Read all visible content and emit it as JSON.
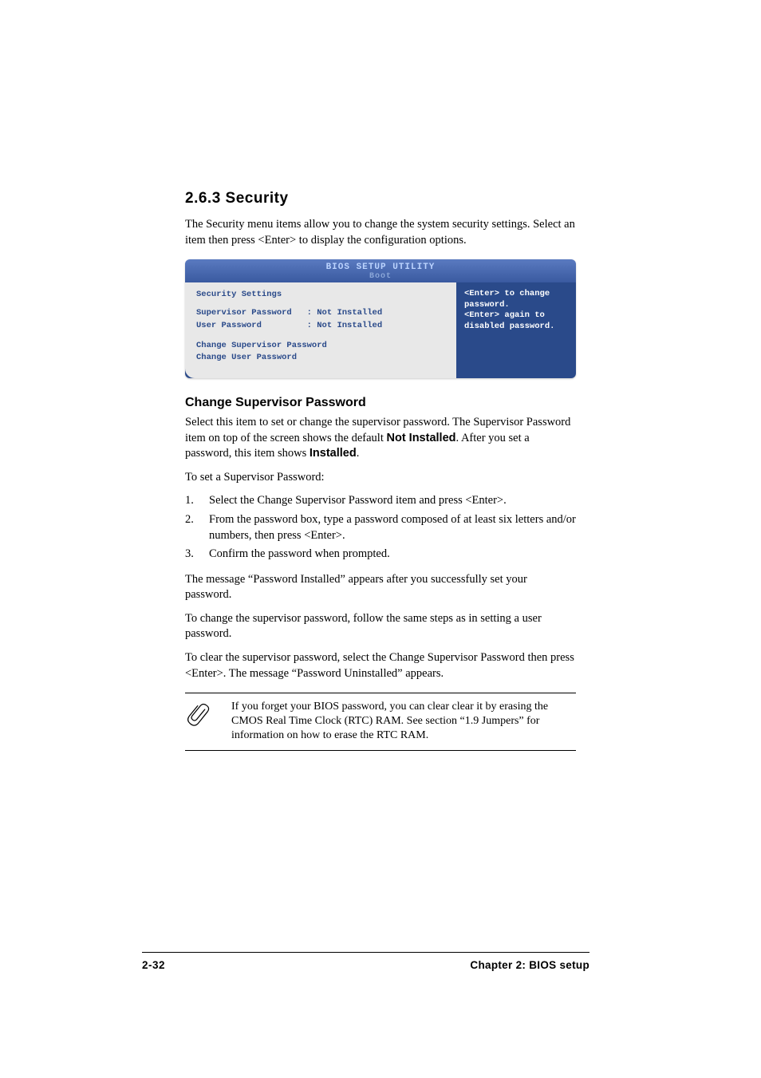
{
  "section": {
    "number": "2.6.3",
    "title": "Security",
    "heading": "2.6.3   Security"
  },
  "intro": "The Security menu items allow you to change the system security settings. Select an item then press <Enter> to display the configuration options.",
  "bios": {
    "header_title": "BIOS SETUP UTILITY",
    "header_sub": "Boot",
    "left_title": "Security Settings",
    "rows": [
      {
        "label": "Supervisor Password",
        "value": ": Not Installed"
      },
      {
        "label": "User Password",
        "value": ": Not Installed"
      }
    ],
    "menu_items": [
      "Change Supervisor Password",
      "Change User Password"
    ],
    "help_text": "<Enter> to change password.\n<Enter> again to disabled password."
  },
  "subheading": "Change Supervisor Password",
  "para1_a": "Select this item to set or change the supervisor password. The Supervisor Password item on top of the screen shows the default ",
  "para1_b": "Not Installed",
  "para1_c": ". After you set a password, this item shows ",
  "para1_d": "Installed",
  "para1_e": ".",
  "para2": "To set a Supervisor Password:",
  "list": [
    {
      "n": "1.",
      "t": "Select the Change Supervisor Password item and press <Enter>."
    },
    {
      "n": "2.",
      "t": "From the password box, type a password composed of at least six letters and/or numbers, then press <Enter>."
    },
    {
      "n": "3.",
      "t": "Confirm the password when prompted."
    }
  ],
  "para3": "The message “Password Installed” appears after you successfully set your password.",
  "para4": "To change the supervisor password, follow the same steps as in setting a user password.",
  "para5": "To clear the supervisor password, select the Change Supervisor Password then press <Enter>. The message “Password Uninstalled” appears.",
  "note": "If you forget your BIOS password, you can clear clear it by erasing the CMOS Real Time Clock (RTC) RAM. See section “1.9  Jumpers” for information on how to erase the RTC RAM.",
  "footer": {
    "page": "2-32",
    "chapter": "Chapter 2: BIOS setup"
  }
}
